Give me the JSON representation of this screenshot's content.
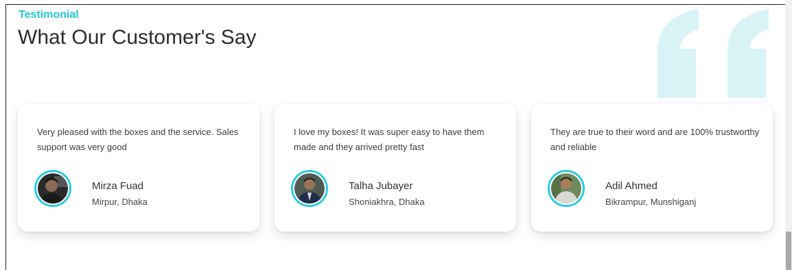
{
  "section": {
    "kicker": "Testimonial",
    "title": "What Our Customer's Say"
  },
  "colors": {
    "accent": "#22c3d9",
    "quote_mark": "#d8f3f6",
    "avatar_ring": "#2cc9e0"
  },
  "testimonials": [
    {
      "quote": "Very pleased with the boxes and the service. Sales support was very good",
      "name": "Mirza Fuad",
      "location": "Mirpur, Dhaka"
    },
    {
      "quote": "I love my boxes! It was super easy to have them made and they arrived pretty fast",
      "name": "Talha Jubayer",
      "location": "Shoniakhra, Dhaka"
    },
    {
      "quote": "They are true to their word and are 100% trustworthy and reliable",
      "name": "Adil Ahmed",
      "location": "Bikrampur, Munshiganj"
    }
  ]
}
